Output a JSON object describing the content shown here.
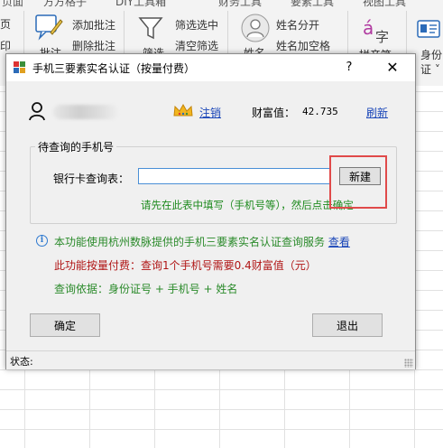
{
  "ribbon": {
    "tabs": [
      "页面",
      "方方格子",
      "DIY工具箱",
      "财务工具",
      "要素工具",
      "视图工具"
    ],
    "left_labels": [
      "页",
      "印"
    ],
    "group1": {
      "add_comment": "添加批注",
      "delete_comment": "删除批注",
      "partial": "批注"
    },
    "group2": {
      "filter_selected": "筛选选中",
      "clear_filter": "清空筛选",
      "partial": "筛选"
    },
    "group3": {
      "name_split": "姓名分开",
      "name_space": "姓名加空格",
      "partial": "姓名"
    },
    "group4": {
      "pinyin_partial": "拼音笔"
    },
    "group5": {
      "identity": "身份",
      "identity_sub": "证 ˅"
    }
  },
  "dialog": {
    "title": "手机三要素实名认证（按量付费）",
    "help": "?",
    "close": "✕",
    "logout": "注销",
    "wealth_label": "财富值：",
    "wealth_value": "42.735",
    "refresh": "刷新",
    "group_title": "待查询的手机号",
    "bank_label": "银行卡查询表：",
    "table_input_value": "",
    "new_button": "新建",
    "hint": "请先在此表中填写（手机号等），然后点击确定",
    "info_text": "本功能使用杭州数脉提供的手机三要素实名认证查询服务",
    "view_link": "查看",
    "price_text": "此功能按量付费：查询1个手机号需要0.4财富值（元）",
    "basis_text": "查询依据：身份证号 + 手机号 + 姓名",
    "ok_button": "确定",
    "exit_button": "退出",
    "status_label": "状态:"
  },
  "colors": {
    "accent_link": "#1a46b8",
    "hint_green": "#1e8a1e",
    "price_red": "#b01515",
    "highlight_red": "#e04a4a"
  }
}
